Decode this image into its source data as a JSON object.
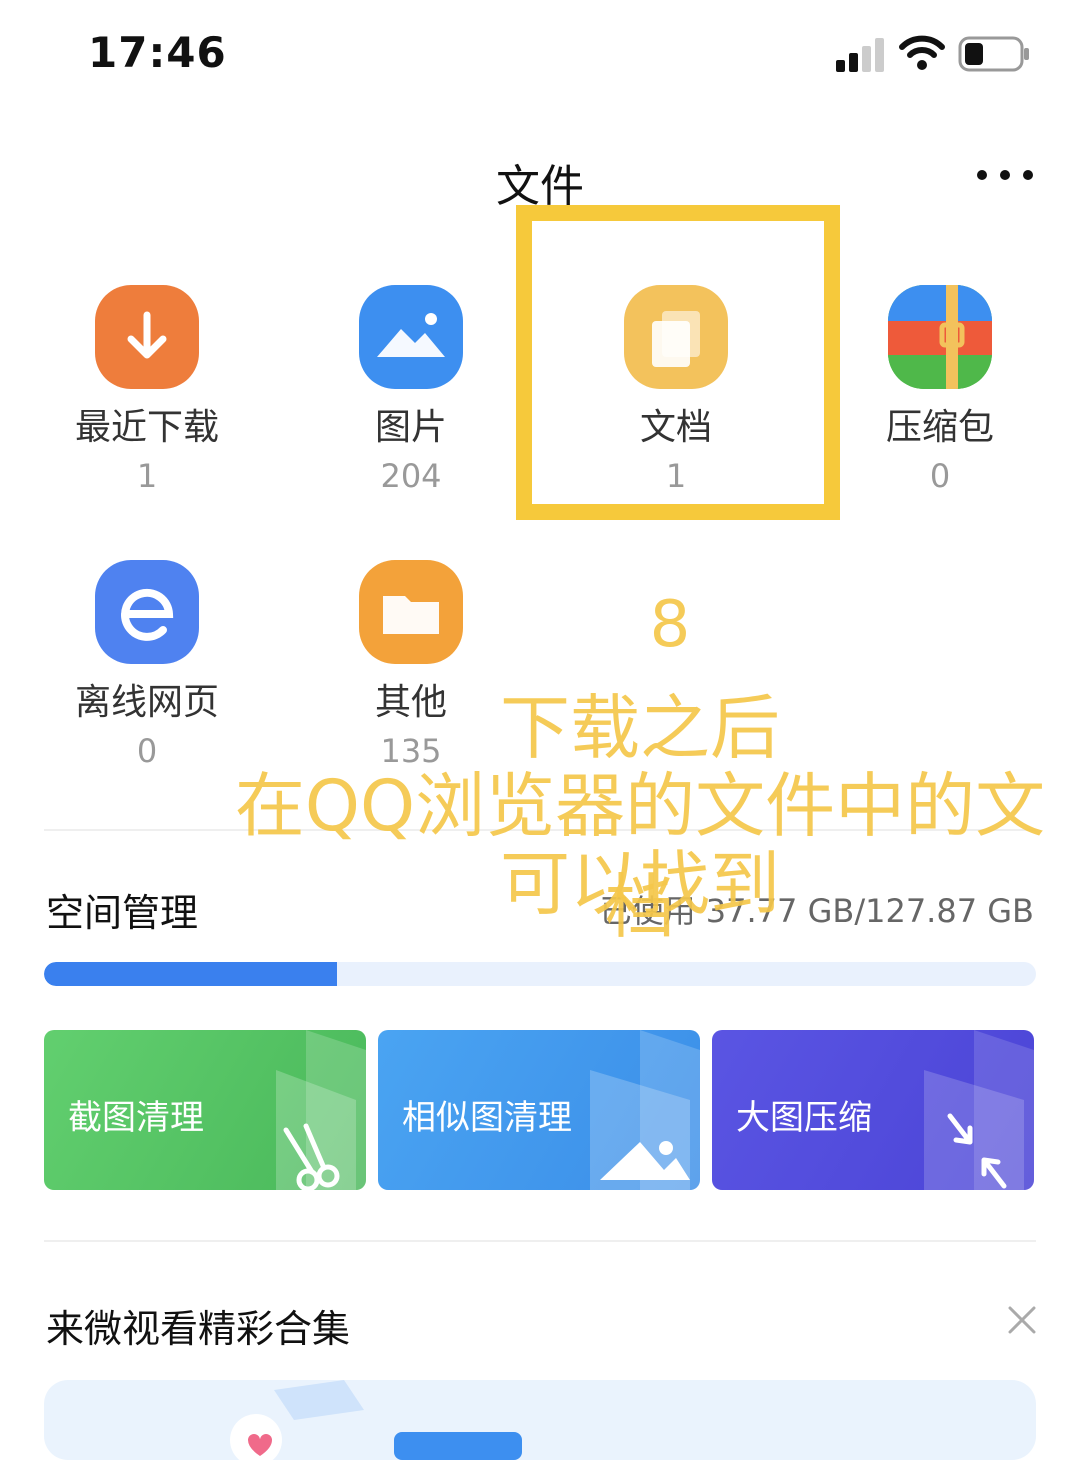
{
  "status_bar": {
    "time": "17:46"
  },
  "header": {
    "title": "文件"
  },
  "categories": [
    {
      "label": "最近下载",
      "count": "1"
    },
    {
      "label": "图片",
      "count": "204"
    },
    {
      "label": "文档",
      "count": "1"
    },
    {
      "label": "压缩包",
      "count": "0"
    },
    {
      "label": "离线网页",
      "count": "0"
    },
    {
      "label": "其他",
      "count": "135"
    }
  ],
  "annotation": {
    "number": "8",
    "line1": "下载之后",
    "line2": "在QQ浏览器的文件中的文档",
    "line3": "可以找到",
    "color": "#f5c74a"
  },
  "storage": {
    "title": "空间管理",
    "used_text": "已使用 37.77 GB/127.87 GB",
    "used_fraction": 0.295
  },
  "tools": [
    {
      "label": "截图清理",
      "color": "#5fcb6b"
    },
    {
      "label": "相似图清理",
      "color": "#4ca6f0"
    },
    {
      "label": "大图压缩",
      "color": "#5a55e3"
    }
  ],
  "feed": {
    "title": "来微视看精彩合集"
  }
}
